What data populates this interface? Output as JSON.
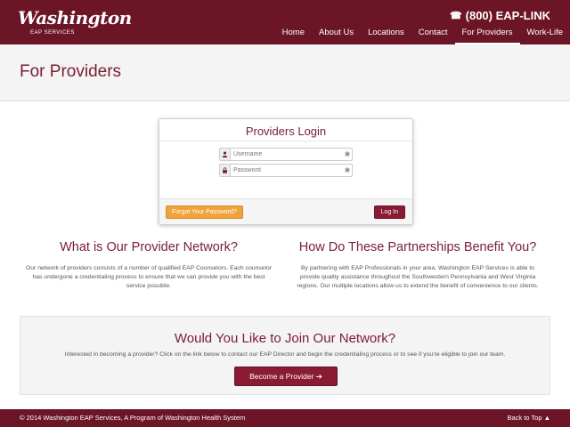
{
  "header": {
    "logo_script": "Washington",
    "logo_sub": "EAP SERVICES",
    "phone_icon": "☎",
    "phone": "(800) EAP-LINK",
    "nav": [
      {
        "label": "Home"
      },
      {
        "label": "About Us"
      },
      {
        "label": "Locations"
      },
      {
        "label": "Contact"
      },
      {
        "label": "For Providers",
        "active": true
      },
      {
        "label": "Work-Life"
      }
    ]
  },
  "page": {
    "title": "For Providers"
  },
  "login": {
    "title": "Providers Login",
    "username_placeholder": "Username",
    "password_placeholder": "Password",
    "user_icon": "user-icon",
    "lock_icon": "lock-icon",
    "required_mark": "✱",
    "forgot_label": "Forgot Your Password?",
    "login_label": "Log In"
  },
  "columns": {
    "left": {
      "heading": "What is Our Provider Network?",
      "body": "Our network of providers consists of a number of qualified EAP Counselors. Each counselor has undergone a credentialing process to ensure that we can provide you with the best service possible."
    },
    "right": {
      "heading": "How Do These Partnerships Benefit You?",
      "body": "By partnering with EAP Professionals in your area, Washington EAP Services is able to provide quality assistance throughout the Southwestern Pennsylvania and West Virginia regions. Our multiple locations allow us to extend the benefit of convenience to our clients."
    }
  },
  "join": {
    "heading": "Would You Like to Join Our Network?",
    "body": "Interested in becoming a provider? Click on the link below to contact our EAP Director and begin the credentialing process or to see if you're eligible to join our team.",
    "button_label": "Become a Provider ➔"
  },
  "footer": {
    "copyright": "© 2014 Washington EAP Services, A Program of Washington Health System",
    "back_to_top": "Back to Top ▲"
  },
  "colors": {
    "brand": "#6b1527",
    "accent": "#8b1a33",
    "warning": "#f0a33a"
  }
}
